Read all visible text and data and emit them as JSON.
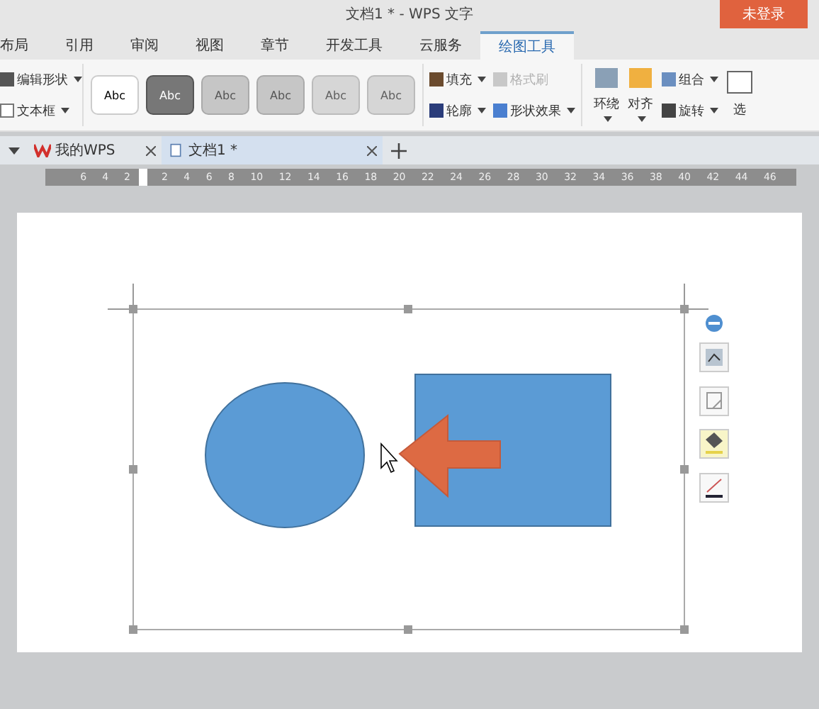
{
  "window": {
    "title": "文档1 * - WPS 文字",
    "login_button": "未登录"
  },
  "menu_tabs": [
    {
      "label": "布局",
      "selected": false
    },
    {
      "label": "引用",
      "selected": false
    },
    {
      "label": "审阅",
      "selected": false
    },
    {
      "label": "视图",
      "selected": false
    },
    {
      "label": "章节",
      "selected": false
    },
    {
      "label": "开发工具",
      "selected": false
    },
    {
      "label": "云服务",
      "selected": false
    },
    {
      "label": "绘图工具",
      "selected": true
    }
  ],
  "ribbon": {
    "shape_group": [
      {
        "label": "编辑形状",
        "dropdown": true
      },
      {
        "label": "文本框",
        "dropdown": true
      }
    ],
    "styles": [
      {
        "label": "Abc",
        "kind": "white"
      },
      {
        "label": "Abc",
        "kind": "dark"
      },
      {
        "label": "Abc",
        "kind": "grey"
      },
      {
        "label": "Abc",
        "kind": "grey"
      },
      {
        "label": "Abc",
        "kind": "light"
      },
      {
        "label": "Abc",
        "kind": "light"
      }
    ],
    "fill_group": [
      {
        "label": "填充",
        "dropdown": true,
        "disabled": false
      },
      {
        "label": "格式刷",
        "dropdown": false,
        "disabled": true
      },
      {
        "label": "轮廓",
        "dropdown": true,
        "disabled": false
      },
      {
        "label": "形状效果",
        "dropdown": true,
        "disabled": false
      }
    ],
    "arrange_group": [
      {
        "label": "环绕",
        "dropdown": true,
        "kind": "large"
      },
      {
        "label": "对齐",
        "dropdown": true,
        "kind": "large"
      },
      {
        "label": "组合",
        "dropdown": true,
        "kind": "small"
      },
      {
        "label": "旋转",
        "dropdown": true,
        "kind": "small"
      },
      {
        "label": "选",
        "kind": "large"
      }
    ]
  },
  "doc_tabs": [
    {
      "label": "我的WPS",
      "selected": false
    },
    {
      "label": "文档1 *",
      "selected": true
    }
  ],
  "ruler": {
    "left_numbers": [
      "6",
      "4",
      "2"
    ],
    "right_numbers": [
      "2",
      "4",
      "6",
      "8",
      "10",
      "12",
      "14",
      "16",
      "18",
      "20",
      "22",
      "24",
      "26",
      "28",
      "30",
      "32",
      "34",
      "36",
      "38",
      "40",
      "42",
      "44",
      "46"
    ]
  }
}
